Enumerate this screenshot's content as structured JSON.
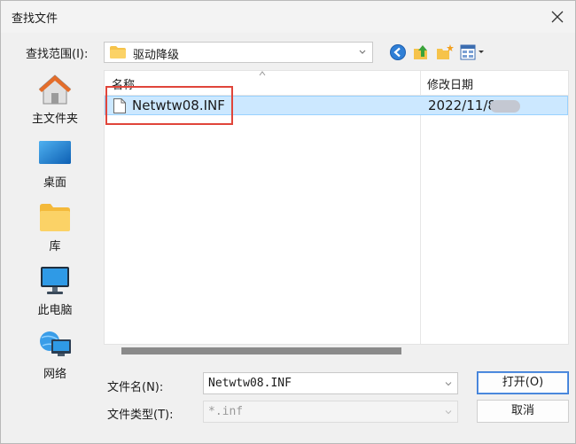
{
  "window": {
    "title": "查找文件"
  },
  "lookin": {
    "label": "查找范围(I):",
    "value": "驱动降级"
  },
  "toolbar": {
    "back": "back-icon",
    "up": "up-folder-icon",
    "new_folder": "new-folder-icon",
    "views": "view-menu-icon"
  },
  "places": [
    {
      "label": "主文件夹",
      "icon": "home-icon"
    },
    {
      "label": "桌面",
      "icon": "desktop-icon"
    },
    {
      "label": "库",
      "icon": "library-folder-icon"
    },
    {
      "label": "此电脑",
      "icon": "computer-icon"
    },
    {
      "label": "网络",
      "icon": "network-icon"
    }
  ],
  "filelist": {
    "columns": {
      "name": "名称",
      "date": "修改日期"
    },
    "rows": [
      {
        "name": "Netwtw08.INF",
        "date": "2022/11/8"
      }
    ]
  },
  "form": {
    "filename_label": "文件名(N):",
    "filename_value": "Netwtw08.INF",
    "filetype_label": "文件类型(T):",
    "filetype_value": "*.inf"
  },
  "buttons": {
    "open": "打开(O)",
    "cancel": "取消"
  },
  "colors": {
    "selection": "#cce8ff",
    "highlight_box": "#e0453a",
    "accent": "#3a7bd5"
  }
}
